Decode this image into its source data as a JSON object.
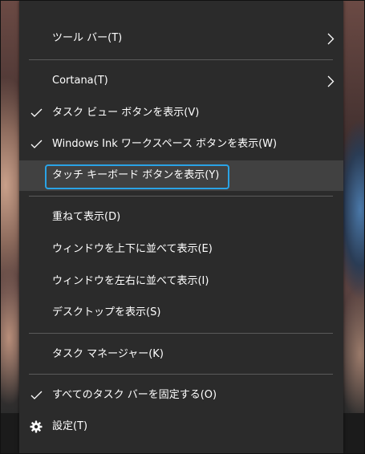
{
  "menu": {
    "items": [
      {
        "label": "ツール バー(T)",
        "submenu": true
      },
      {
        "label": "Cortana(T)",
        "submenu": true
      },
      {
        "label": "タスク ビュー ボタンを表示(V)",
        "checked": true
      },
      {
        "label": "Windows Ink ワークスペース ボタンを表示(W)",
        "checked": true
      },
      {
        "label": "タッチ キーボード ボタンを表示(Y)",
        "highlighted": true
      },
      {
        "label": "重ねて表示(D)"
      },
      {
        "label": "ウィンドウを上下に並べて表示(E)"
      },
      {
        "label": "ウィンドウを左右に並べて表示(I)"
      },
      {
        "label": "デスクトップを表示(S)"
      },
      {
        "label": "タスク マネージャー(K)"
      },
      {
        "label": "すべてのタスク バーを固定する(O)",
        "checked": true
      },
      {
        "label": "設定(T)",
        "icon": "gear-icon"
      }
    ]
  },
  "colors": {
    "menu_bg": "#2b2b2b",
    "highlight_bg": "#414141",
    "focus_ring": "#2aa3e6",
    "text": "#ffffff"
  }
}
